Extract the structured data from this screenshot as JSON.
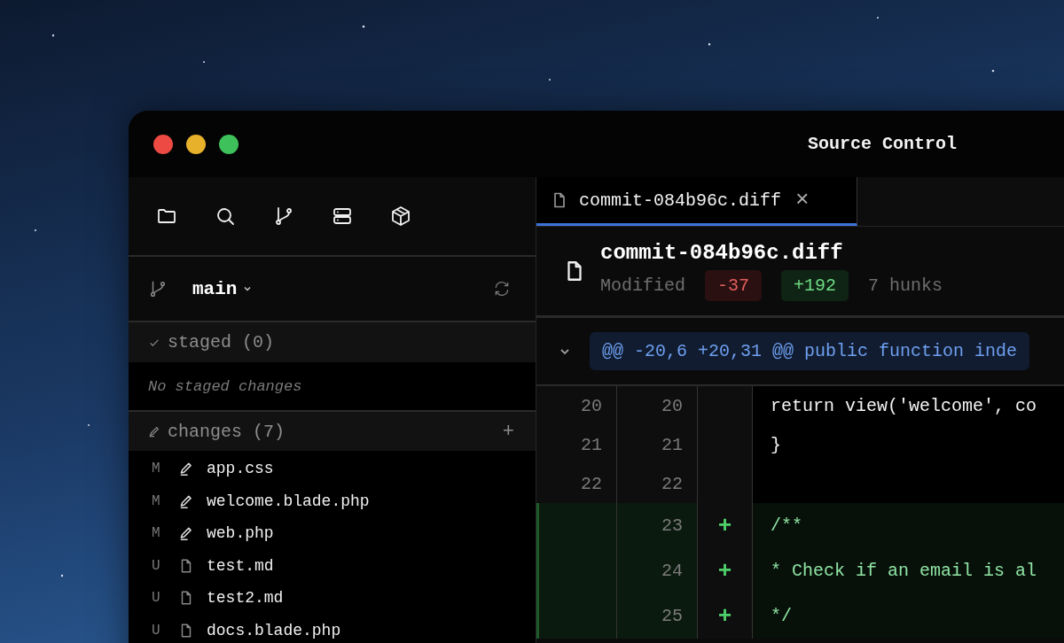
{
  "window": {
    "title": "Source Control"
  },
  "branch": {
    "name": "main"
  },
  "staged": {
    "label": "staged (0)",
    "empty_text": "No staged changes"
  },
  "changes": {
    "label": "changes (7)",
    "add_glyph": "+",
    "files": [
      {
        "status": "M",
        "kind": "modified",
        "name": "app.css"
      },
      {
        "status": "M",
        "kind": "modified",
        "name": "welcome.blade.php"
      },
      {
        "status": "M",
        "kind": "modified",
        "name": "web.php"
      },
      {
        "status": "U",
        "kind": "untracked",
        "name": "test.md"
      },
      {
        "status": "U",
        "kind": "untracked",
        "name": "test2.md"
      },
      {
        "status": "U",
        "kind": "untracked",
        "name": "docs.blade.php"
      }
    ]
  },
  "tabs": [
    {
      "label": "commit-084b96c.diff",
      "selected": true,
      "close_glyph": "×"
    }
  ],
  "file_header": {
    "name": "commit-084b96c.diff",
    "status": "Modified",
    "deletions": "-37",
    "additions": "+192",
    "hunks": "7 hunks"
  },
  "hunk": {
    "header": "@@ -20,6 +20,31 @@ public function inde",
    "expanded": true
  },
  "lines": [
    {
      "kind": "context",
      "old": "20",
      "new": "20",
      "code": "return view('welcome', co"
    },
    {
      "kind": "context",
      "old": "21",
      "new": "21",
      "code": "}"
    },
    {
      "kind": "context",
      "old": "22",
      "new": "22"
    },
    {
      "kind": "added",
      "new": "23",
      "sign": "+",
      "code": "/**"
    },
    {
      "kind": "added",
      "new": "24",
      "sign": "+",
      "code": "* Check if an email is al"
    },
    {
      "kind": "added",
      "new": "25",
      "sign": "+",
      "code": "*/"
    }
  ]
}
